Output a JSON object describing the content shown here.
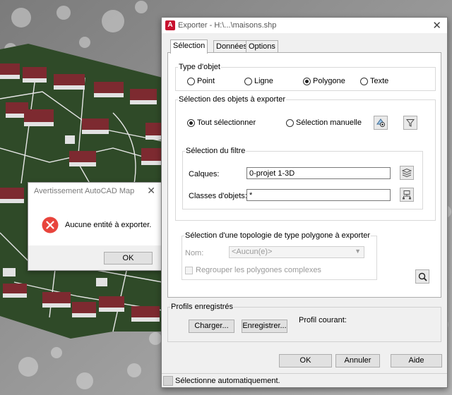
{
  "warning_dialog": {
    "title": "Avertissement AutoCAD Map",
    "message": "Aucune entité à exporter.",
    "ok_label": "OK"
  },
  "export_dialog": {
    "title": "Exporter - H:\\...\\maisons.shp",
    "tabs": [
      "Sélection",
      "Données",
      "Options"
    ],
    "object_type": {
      "label": "Type d'objet",
      "options": [
        "Point",
        "Ligne",
        "Polygone",
        "Texte"
      ],
      "selected": "Polygone"
    },
    "object_selection": {
      "label": "Sélection des objets à exporter",
      "select_all": "Tout sélectionner",
      "manual": "Sélection manuelle",
      "selected": "Tout sélectionner"
    },
    "filter": {
      "label": "Sélection du filtre",
      "layers_label": "Calques:",
      "layers_value": "0-projet 1-3D",
      "classes_label": "Classes d'objets:",
      "classes_value": "*"
    },
    "topology": {
      "label": "Sélection d'une topologie de type polygone à exporter",
      "name_label": "Nom:",
      "name_value": "<Aucun(e)>",
      "group_label": "Regrouper les polygones complexes"
    },
    "profiles": {
      "label": "Profils enregistrés",
      "load_label": "Charger...",
      "save_label": "Enregistrer...",
      "current_label": "Profil courant:"
    },
    "buttons": {
      "ok": "OK",
      "cancel": "Annuler",
      "help": "Aide"
    },
    "status": "Sélectionne automatiquement."
  },
  "colors": {
    "terrain": "#2f4a28",
    "roof": "#7d2a30",
    "error_red": "#e8443c"
  }
}
